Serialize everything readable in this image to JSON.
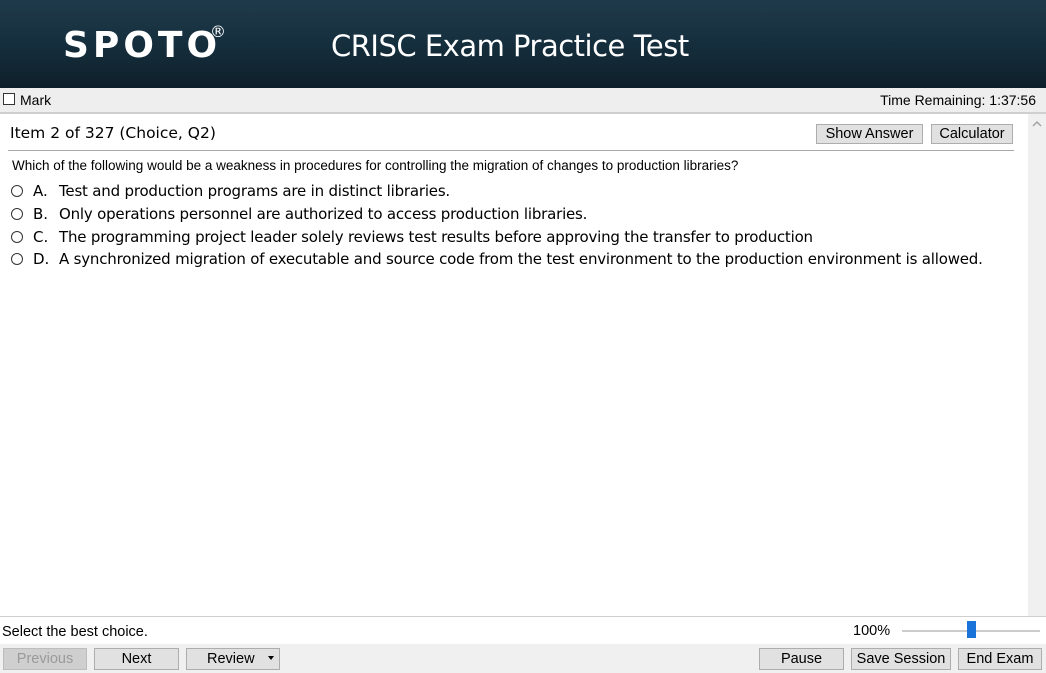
{
  "header": {
    "logo": "SPOTO",
    "logo_mark": "®",
    "title": "CRISC Exam Practice Test"
  },
  "markbar": {
    "mark_label": "Mark",
    "time_remaining": "Time Remaining: 1:37:56"
  },
  "question": {
    "item_info": "Item 2 of 327 (Choice, Q2)",
    "show_answer_label": "Show Answer",
    "calculator_label": "Calculator",
    "text": "Which of the following would be a weakness in procedures for controlling the migration of changes to production libraries?",
    "choices": [
      {
        "letter": "A.",
        "text": "Test and production programs are in distinct libraries."
      },
      {
        "letter": "B.",
        "text": "Only operations personnel are authorized to access production libraries."
      },
      {
        "letter": "C.",
        "text": "The programming project leader solely reviews test results before approving the transfer to production"
      },
      {
        "letter": "D.",
        "text": "A synchronized migration of executable and source code from the test environment to the production environment is allowed."
      }
    ]
  },
  "statusbar": {
    "instruction": "Select the best choice.",
    "zoom": "100%",
    "zoom_level": 0.5
  },
  "navbar": {
    "previous_label": "Previous",
    "next_label": "Next",
    "review_label": "Review",
    "pause_label": "Pause",
    "save_session_label": "Save Session",
    "end_exam_label": "End Exam"
  },
  "colors": {
    "banner": "#16303f",
    "accent": "#1a73d9",
    "button_bg": "#e1e1e1"
  },
  "icons": {
    "mark_checkbox": "checkbox-icon",
    "choice_radio": "radio-icon",
    "scroll_up": "chevron-up-icon",
    "review_dropdown": "caret-down-icon"
  }
}
